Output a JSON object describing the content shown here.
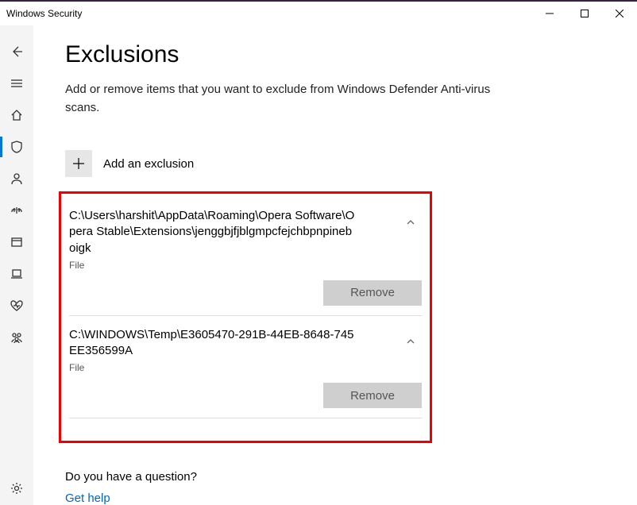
{
  "window": {
    "title": "Windows Security"
  },
  "page": {
    "heading": "Exclusions",
    "subtitle": "Add or remove items that you want to exclude from Windows Defender Anti-virus scans.",
    "add_label": "Add an exclusion"
  },
  "exclusions": [
    {
      "path": "C:\\Users\\harshit\\AppData\\Roaming\\Opera Software\\Opera Stable\\Extensions\\jenggbjfjblgmpcfejchbpnpineboigk",
      "type": "File",
      "remove_label": "Remove"
    },
    {
      "path": "C:\\WINDOWS\\Temp\\E3605470-291B-44EB-8648-745EE356599A",
      "type": "File",
      "remove_label": "Remove"
    }
  ],
  "help": {
    "question": "Do you have a question?",
    "link": "Get help"
  }
}
